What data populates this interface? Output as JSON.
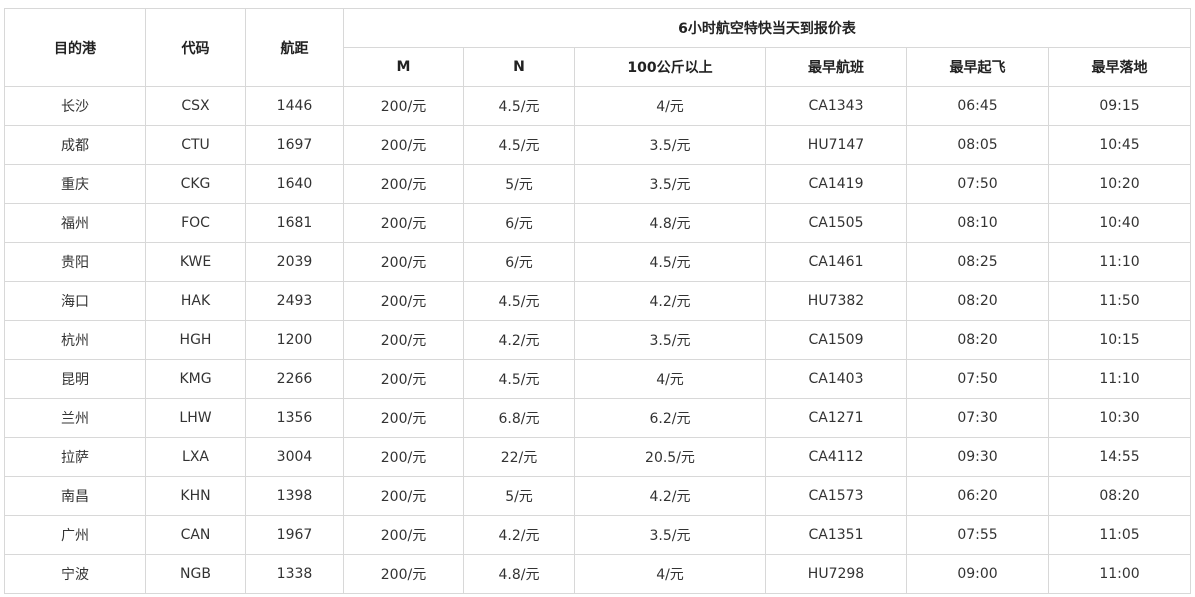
{
  "table": {
    "group_header": "6小时航空特快当天到报价表",
    "headers": {
      "dest": "目的港",
      "code": "代码",
      "distance": "航距",
      "m": "M",
      "n": "N",
      "over100": "100公斤以上",
      "flight": "最早航班",
      "takeoff": "最早起飞",
      "landing": "最早落地"
    },
    "rows": [
      [
        "长沙",
        "CSX",
        "1446",
        "200/元",
        "4.5/元",
        "4/元",
        "CA1343",
        "06:45",
        "09:15"
      ],
      [
        "成都",
        "CTU",
        "1697",
        "200/元",
        "4.5/元",
        "3.5/元",
        "HU7147",
        "08:05",
        "10:45"
      ],
      [
        "重庆",
        "CKG",
        "1640",
        "200/元",
        "5/元",
        "3.5/元",
        "CA1419",
        "07:50",
        "10:20"
      ],
      [
        "福州",
        "FOC",
        "1681",
        "200/元",
        "6/元",
        "4.8/元",
        "CA1505",
        "08:10",
        "10:40"
      ],
      [
        "贵阳",
        "KWE",
        "2039",
        "200/元",
        "6/元",
        "4.5/元",
        "CA1461",
        "08:25",
        "11:10"
      ],
      [
        "海口",
        "HAK",
        "2493",
        "200/元",
        "4.5/元",
        "4.2/元",
        "HU7382",
        "08:20",
        "11:50"
      ],
      [
        "杭州",
        "HGH",
        "1200",
        "200/元",
        "4.2/元",
        "3.5/元",
        "CA1509",
        "08:20",
        "10:15"
      ],
      [
        "昆明",
        "KMG",
        "2266",
        "200/元",
        "4.5/元",
        "4/元",
        "CA1403",
        "07:50",
        "11:10"
      ],
      [
        "兰州",
        "LHW",
        "1356",
        "200/元",
        "6.8/元",
        "6.2/元",
        "CA1271",
        "07:30",
        "10:30"
      ],
      [
        "拉萨",
        "LXA",
        "3004",
        "200/元",
        "22/元",
        "20.5/元",
        "CA4112",
        "09:30",
        "14:55"
      ],
      [
        "南昌",
        "KHN",
        "1398",
        "200/元",
        "5/元",
        "4.2/元",
        "CA1573",
        "06:20",
        "08:20"
      ],
      [
        "广州",
        "CAN",
        "1967",
        "200/元",
        "4.2/元",
        "3.5/元",
        "CA1351",
        "07:55",
        "11:05"
      ],
      [
        "宁波",
        "NGB",
        "1338",
        "200/元",
        "4.8/元",
        "4/元",
        "HU7298",
        "09:00",
        "11:00"
      ]
    ]
  }
}
